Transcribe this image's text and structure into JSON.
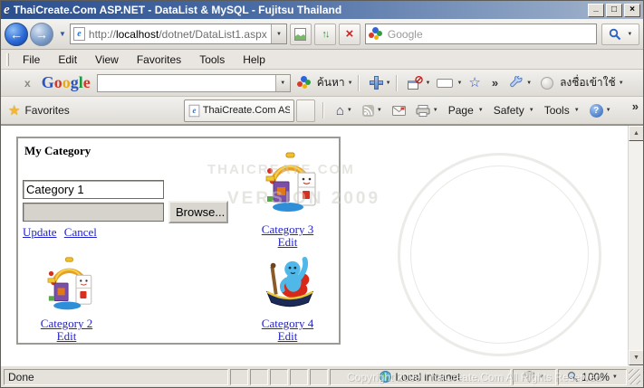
{
  "window": {
    "title": "ThaiCreate.Com ASP.NET - DataList & MySQL - Fujitsu Thailand",
    "controls": {
      "minimize": "_",
      "maximize": "□",
      "close": "×"
    }
  },
  "icons": {
    "ie_logo": "e",
    "dropdown": "▼",
    "scroll_up": "▲",
    "scroll_down": "▼",
    "back": "←",
    "forward": "→",
    "refresh": "↑↓",
    "stop": "×",
    "home": "⌂",
    "mail": "✉",
    "help": "?",
    "favorites_star": "★",
    "bookmark_star": "☆",
    "popup_blocked": "⊘"
  },
  "navigation": {
    "url_scheme": "http://",
    "url_domain": "localhost",
    "url_path": "/dotnet/DataList1.aspx",
    "search_placeholder": "Google"
  },
  "menu_bar": {
    "items": [
      "File",
      "Edit",
      "View",
      "Favorites",
      "Tools",
      "Help"
    ]
  },
  "google_toolbar": {
    "close_label": "x",
    "logo_letters": [
      {
        "ch": "G",
        "color": "#2a53c4"
      },
      {
        "ch": "o",
        "color": "#d3392a"
      },
      {
        "ch": "o",
        "color": "#eda912"
      },
      {
        "ch": "g",
        "color": "#2a53c4"
      },
      {
        "ch": "l",
        "color": "#1b9b3c"
      },
      {
        "ch": "e",
        "color": "#d3392a"
      }
    ],
    "search_label": "ค้นหา",
    "overflow_chevron": "»",
    "sign_in_label": "ลงชื่อเข้าใช้"
  },
  "command_bar": {
    "favorites_label": "Favorites",
    "tab_title": "ThaiCreate.Com ASP.NET - DataList & ...",
    "page_label": "Page",
    "safety_label": "Safety",
    "tools_label": "Tools",
    "overflow_chevron": "»"
  },
  "page": {
    "heading": "My Category",
    "link_color": "#2222cc",
    "editor": {
      "category_name_value": "Category 1",
      "browse_label": "Browse...",
      "update_label": "Update",
      "cancel_label": "Cancel"
    },
    "items": [
      {
        "label": "Category 3",
        "edit_label": "Edit",
        "image": "toy-activity-center"
      },
      {
        "label": "Category 2",
        "edit_label": "Edit",
        "image": "toy-activity-center"
      },
      {
        "label": "Category 4",
        "edit_label": "Edit",
        "image": "toy-boat-character"
      }
    ]
  },
  "watermarks": {
    "stamp_line1": "THAICREATE.COM",
    "stamp_line2": "VERSION 2009",
    "footer": "Copyright 2009 ThaiCreate.Com All Rights Reserved"
  },
  "status_bar": {
    "status_text": "Done",
    "zone_label": "Local intranet",
    "zoom_value": "100%"
  }
}
